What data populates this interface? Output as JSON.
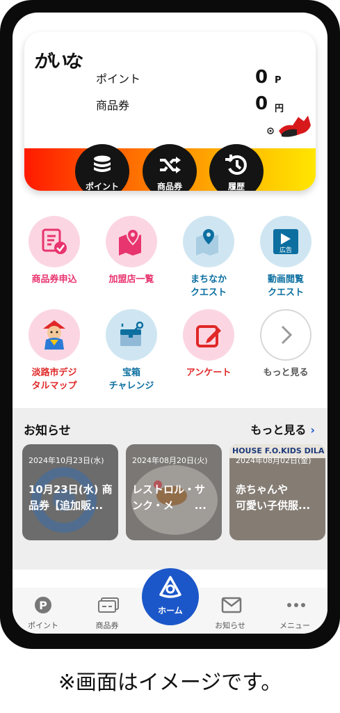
{
  "brand": {
    "logo_text": "がいな"
  },
  "balance": {
    "points_label": "ポイント",
    "points_value": "0",
    "points_unit": "P",
    "voucher_label": "商品券",
    "voucher_value": "0",
    "voucher_unit": "円"
  },
  "card_buttons": [
    {
      "label": "ポイント",
      "icon": "coins-icon"
    },
    {
      "label": "商品券",
      "icon": "shuffle-icon"
    },
    {
      "label": "履歴",
      "icon": "history-icon"
    }
  ],
  "menu": [
    {
      "label": "商品券申込",
      "icon": "application-form-icon"
    },
    {
      "label": "加盟店一覧",
      "icon": "map-pin-icon"
    },
    {
      "label": "まちなか\nクエスト",
      "icon": "quest-map-icon"
    },
    {
      "label": "動画閲覧\nクエスト",
      "icon": "video-ad-icon",
      "badge": "広告"
    },
    {
      "label": "淡路市デジ\nタルマップ",
      "icon": "mascot-icon"
    },
    {
      "label": "宝箱\nチャレンジ",
      "icon": "treasure-box-icon"
    },
    {
      "label": "アンケート",
      "icon": "survey-edit-icon"
    },
    {
      "label": "もっと見る",
      "icon": "chevron-right-icon"
    }
  ],
  "news": {
    "title": "お知らせ",
    "more_label": "もっと見る",
    "items": [
      {
        "date": "2024年10月23日(水)",
        "text": "10月23日(水) 商\n品券【追加販..."
      },
      {
        "date": "2024年08月20日(火)",
        "text": "レストロル・サ\nンク・メ　　..."
      },
      {
        "date": "2024年08月02日(金)",
        "text": "赤ちゃんや\n可愛い子供服...",
        "banner": "HOUSE  F.O.KIDS  DILA"
      }
    ]
  },
  "tabs": [
    {
      "label": "ポイント",
      "icon": "point-p-icon"
    },
    {
      "label": "商品券",
      "icon": "voucher-icon"
    },
    {
      "label": "ホーム",
      "icon": "home-logo-icon"
    },
    {
      "label": "お知らせ",
      "icon": "mail-icon"
    },
    {
      "label": "メニュー",
      "icon": "more-dots-icon"
    }
  ],
  "caption": "※画面はイメージです。",
  "colors": {
    "accent_blue": "#1c57c9",
    "pink": "#e8346f",
    "red": "#e02828",
    "teal": "#0c6fa0"
  }
}
